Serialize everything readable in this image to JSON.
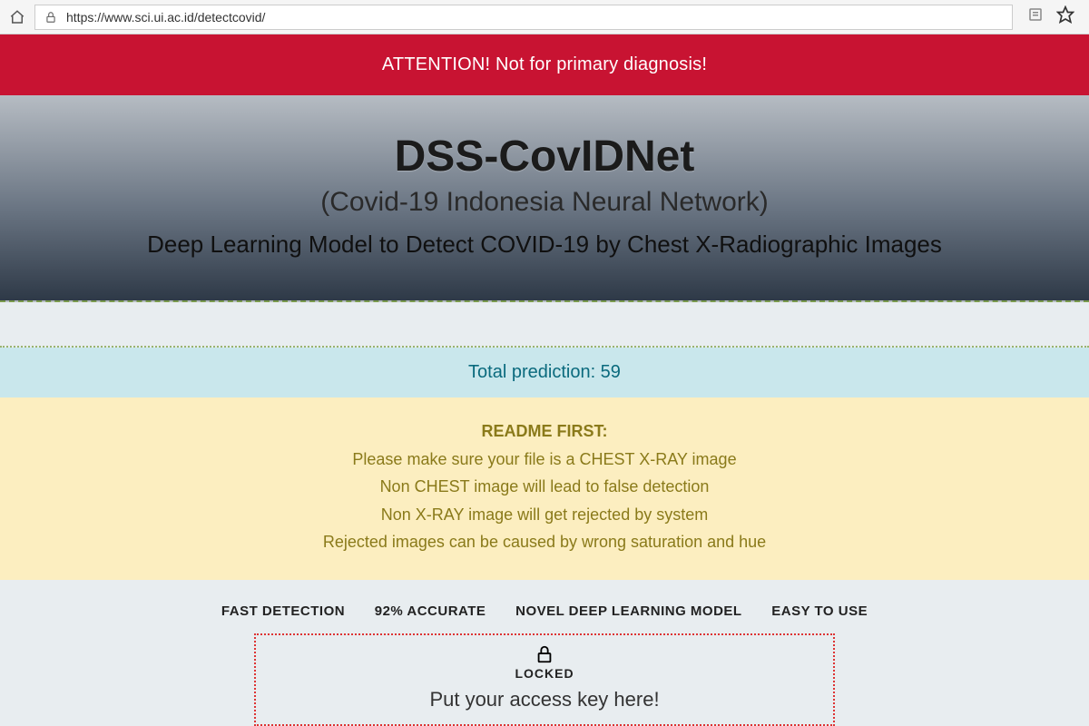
{
  "browser": {
    "url": "https://www.sci.ui.ac.id/detectcovid/"
  },
  "banner": {
    "text": "ATTENTION! Not for primary diagnosis!"
  },
  "hero": {
    "title": "DSS-CovIDNet",
    "subtitle": "(Covid-19 Indonesia Neural Network)",
    "tagline": "Deep Learning Model to Detect COVID-19 by Chest X-Radiographic Images"
  },
  "stats": {
    "total_prediction_label": "Total prediction: 59"
  },
  "readme": {
    "title": "README FIRST:",
    "lines": [
      "Please make sure your file is a CHEST X-RAY image",
      "Non CHEST image will lead to false detection",
      "Non X-RAY image will get rejected by system",
      "Rejected images can be caused by wrong saturation and hue"
    ]
  },
  "features": {
    "items": [
      "FAST DETECTION",
      "92% ACCURATE",
      "NOVEL DEEP LEARNING MODEL",
      "EASY TO USE"
    ]
  },
  "locked": {
    "label": "LOCKED",
    "prompt": "Put your access key here!"
  }
}
